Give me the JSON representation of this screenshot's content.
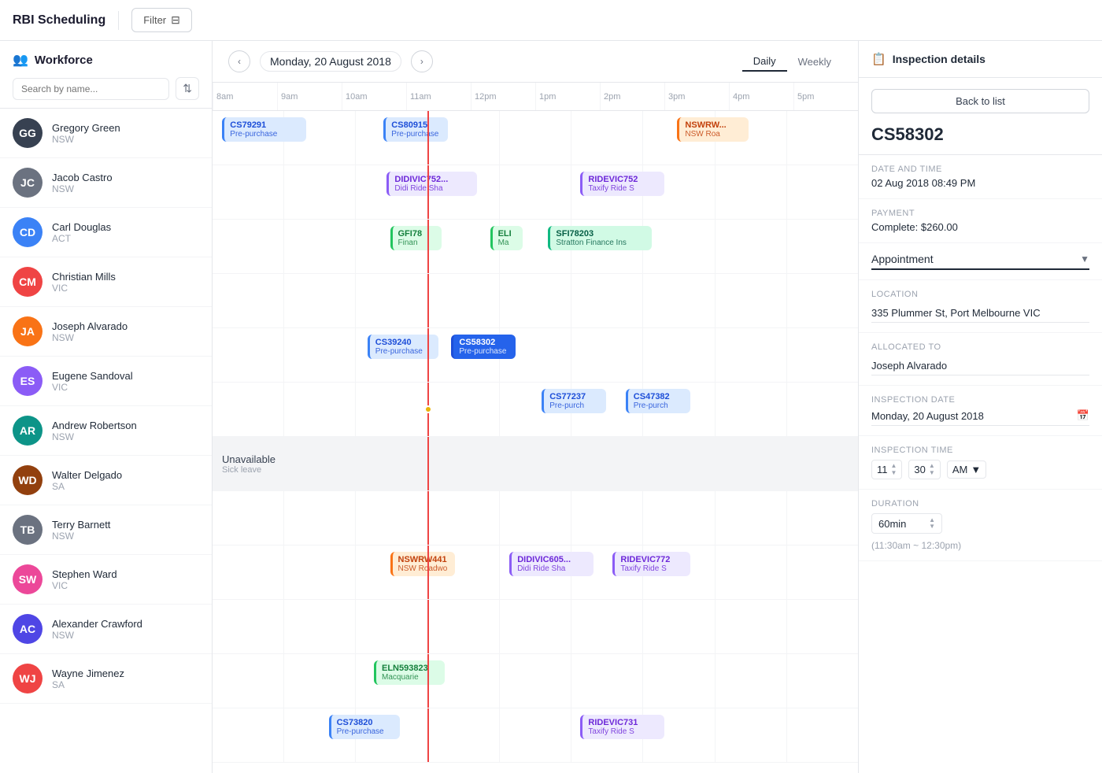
{
  "app": {
    "title": "RBI Scheduling",
    "filter_label": "Filter"
  },
  "sidebar": {
    "title": "Workforce",
    "search_placeholder": "Search by name...",
    "workers": [
      {
        "id": "w1",
        "name": "Gregory Green",
        "state": "NSW",
        "av_color": "av-g2",
        "initials": "GG"
      },
      {
        "id": "w2",
        "name": "Jacob Castro",
        "state": "NSW",
        "av_color": "av-g1",
        "initials": "JC"
      },
      {
        "id": "w3",
        "name": "Carl Douglas",
        "state": "ACT",
        "av_color": "av-b1",
        "initials": "CD"
      },
      {
        "id": "w4",
        "name": "Christian Mills",
        "state": "VIC",
        "av_color": "av-r1",
        "initials": "CM"
      },
      {
        "id": "w5",
        "name": "Joseph Alvarado",
        "state": "NSW",
        "av_color": "av-o1",
        "initials": "JA"
      },
      {
        "id": "w6",
        "name": "Eugene Sandoval",
        "state": "VIC",
        "av_color": "av-p1",
        "initials": "ES"
      },
      {
        "id": "w7",
        "name": "Andrew Robertson",
        "state": "NSW",
        "av_color": "av-t1",
        "initials": "AR"
      },
      {
        "id": "w8",
        "name": "Walter Delgado",
        "state": "SA",
        "av_color": "av-br",
        "initials": "WD"
      },
      {
        "id": "w9",
        "name": "Terry Barnett",
        "state": "NSW",
        "av_color": "av-g1",
        "initials": "TB"
      },
      {
        "id": "w10",
        "name": "Stephen Ward",
        "state": "VIC",
        "av_color": "av-pink",
        "initials": "SW"
      },
      {
        "id": "w11",
        "name": "Alexander Crawford",
        "state": "NSW",
        "av_color": "av-in",
        "initials": "AC"
      },
      {
        "id": "w12",
        "name": "Wayne Jimenez",
        "state": "SA",
        "av_color": "av-r1",
        "initials": "WJ"
      }
    ]
  },
  "calendar": {
    "current_date": "Monday, 20 August 2018",
    "view_daily": "Daily",
    "view_weekly": "Weekly",
    "time_slots": [
      "8am",
      "9am",
      "10am",
      "11am",
      "12pm",
      "1pm",
      "2pm",
      "3pm",
      "4pm",
      "5pm"
    ]
  },
  "panel": {
    "title": "Inspection details",
    "back_label": "Back to list",
    "inspection_id": "CS58302",
    "date_time_label": "Date and time",
    "date_time_value": "02 Aug 2018 08:49 PM",
    "payment_label": "Payment",
    "payment_value": "Complete: $260.00",
    "appointment_label": "Appointment",
    "location_label": "Location",
    "location_value": "335 Plummer St, Port Melbourne VIC",
    "allocated_label": "Allocated to",
    "allocated_value": "Joseph Alvarado",
    "inspection_date_label": "Inspection date",
    "inspection_date_value": "Monday, 20 August 2018",
    "inspection_time_label": "Inspection time",
    "time_hour": "11",
    "time_min": "30",
    "time_ampm": "AM",
    "duration_label": "Duration",
    "duration_value": "60min",
    "time_note": "(11:30am ~ 12:30pm)"
  },
  "appointments": {
    "row1": [
      {
        "id": "CS79291",
        "sub": "Pre-purchase",
        "color": "blue",
        "left_pct": 1.5,
        "width_pct": 13
      },
      {
        "id": "CS80915",
        "sub": "Pre-purchase",
        "color": "blue",
        "left_pct": 26.5,
        "width_pct": 10
      },
      {
        "id": "NSWRW...",
        "sub": "NSW Roa",
        "color": "orange",
        "left_pct": 72,
        "width_pct": 11
      }
    ],
    "row2": [
      {
        "id": "DIDIVIC752...",
        "sub": "Didi Ride Sha",
        "color": "purple",
        "left_pct": 27,
        "width_pct": 14
      },
      {
        "id": "RIDEVIC752",
        "sub": "Taxify Ride S",
        "color": "purple",
        "left_pct": 57,
        "width_pct": 13
      }
    ],
    "row3": [
      {
        "id": "GFI78",
        "sub": "Finan",
        "color": "green",
        "left_pct": 27.5,
        "width_pct": 8
      },
      {
        "id": "ELI",
        "sub": "Ma",
        "color": "green",
        "left_pct": 43,
        "width_pct": 5
      },
      {
        "id": "SFI78203",
        "sub": "Stratton Finance Ins",
        "color": "teal",
        "left_pct": 52,
        "width_pct": 16
      }
    ],
    "row5": [
      {
        "id": "CS39240",
        "sub": "Pre-purchase",
        "color": "blue",
        "left_pct": 24,
        "width_pct": 11
      },
      {
        "id": "CS58302",
        "sub": "Pre-purchase",
        "color": "blue-dark",
        "left_pct": 37,
        "width_pct": 10
      }
    ],
    "row6": [
      {
        "id": "CS77237",
        "sub": "Pre-purch",
        "color": "blue",
        "left_pct": 51,
        "width_pct": 10
      },
      {
        "id": "CS47382",
        "sub": "Pre-purch",
        "color": "blue",
        "left_pct": 64,
        "width_pct": 10
      }
    ],
    "row9": [
      {
        "id": "NSWRW441",
        "sub": "NSW Roadwo",
        "color": "orange",
        "left_pct": 27.5,
        "width_pct": 10
      },
      {
        "id": "DIDIVIC605...",
        "sub": "Didi Ride Sha",
        "color": "purple",
        "left_pct": 46,
        "width_pct": 13
      },
      {
        "id": "RIDEVIC772",
        "sub": "Taxify Ride S",
        "color": "purple",
        "left_pct": 62,
        "width_pct": 12
      }
    ],
    "row11": [
      {
        "id": "ELN593823",
        "sub": "Macquarie",
        "color": "green",
        "left_pct": 25,
        "width_pct": 11
      }
    ],
    "row12": [
      {
        "id": "CS73820",
        "sub": "Pre-purchase",
        "color": "blue",
        "left_pct": 18,
        "width_pct": 11
      },
      {
        "id": "RIDEVIC731",
        "sub": "Taxify Ride S",
        "color": "purple",
        "left_pct": 57,
        "width_pct": 13
      }
    ]
  }
}
